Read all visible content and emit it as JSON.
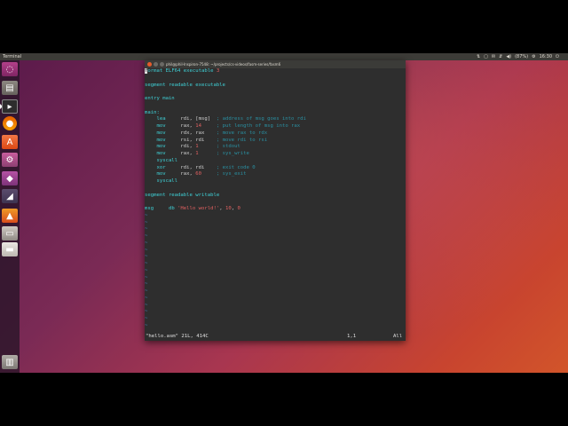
{
  "topbar": {
    "app_name": "Terminal",
    "indicators": [
      "⇅",
      "▢",
      "✉",
      "⇵",
      "◀)",
      "(87%)",
      "⚙",
      "16:30",
      "⏻"
    ]
  },
  "launcher": {
    "items": [
      {
        "name": "ubuntu-dash"
      },
      {
        "name": "files"
      },
      {
        "name": "terminal"
      },
      {
        "name": "firefox"
      },
      {
        "name": "software-center"
      },
      {
        "name": "system-settings"
      },
      {
        "name": "app"
      },
      {
        "name": "app"
      },
      {
        "name": "app"
      },
      {
        "name": "app"
      },
      {
        "name": "app"
      },
      {
        "name": "trash"
      }
    ]
  },
  "window": {
    "title": "phil@phil-Inspiron-7548: ~/projects/cs-videos/fasm-series/fasm6"
  },
  "editor": {
    "lines": [
      [
        {
          "t": "f",
          "c": "cursor"
        },
        {
          "t": "ormat ELF64 executable ",
          "c": "kw"
        },
        {
          "t": "3",
          "c": "num"
        }
      ],
      [],
      [
        {
          "t": "segment readable executable",
          "c": "kw"
        }
      ],
      [],
      [
        {
          "t": "entry main",
          "c": "kw"
        }
      ],
      [],
      [
        {
          "t": "main:",
          "c": "lbl"
        }
      ],
      [
        {
          "t": "    lea     ",
          "c": "mnem"
        },
        {
          "t": "rdi, [msg]  ",
          "c": "plain"
        },
        {
          "t": "; address of msg goes into rdi",
          "c": "cmt"
        }
      ],
      [
        {
          "t": "    mov     ",
          "c": "mnem"
        },
        {
          "t": "rax, ",
          "c": "plain"
        },
        {
          "t": "14",
          "c": "num"
        },
        {
          "t": "     ",
          "c": "plain"
        },
        {
          "t": "; put length of msg into rax",
          "c": "cmt"
        }
      ],
      [
        {
          "t": "    mov     ",
          "c": "mnem"
        },
        {
          "t": "rdx, rax    ",
          "c": "plain"
        },
        {
          "t": "; move rax to rdx",
          "c": "cmt"
        }
      ],
      [
        {
          "t": "    mov     ",
          "c": "mnem"
        },
        {
          "t": "rsi, rdi    ",
          "c": "plain"
        },
        {
          "t": "; move rdi to rsi",
          "c": "cmt"
        }
      ],
      [
        {
          "t": "    mov     ",
          "c": "mnem"
        },
        {
          "t": "rdi, ",
          "c": "plain"
        },
        {
          "t": "1",
          "c": "num"
        },
        {
          "t": "      ",
          "c": "plain"
        },
        {
          "t": "; stdout",
          "c": "cmt"
        }
      ],
      [
        {
          "t": "    mov     ",
          "c": "mnem"
        },
        {
          "t": "rax, ",
          "c": "plain"
        },
        {
          "t": "1",
          "c": "num"
        },
        {
          "t": "      ",
          "c": "plain"
        },
        {
          "t": "; sys_write",
          "c": "cmt"
        }
      ],
      [
        {
          "t": "    syscall",
          "c": "mnem"
        }
      ],
      [
        {
          "t": "    xor     ",
          "c": "mnem"
        },
        {
          "t": "rdi, rdi    ",
          "c": "plain"
        },
        {
          "t": "; exit code 0",
          "c": "cmt"
        }
      ],
      [
        {
          "t": "    mov     ",
          "c": "mnem"
        },
        {
          "t": "rax, ",
          "c": "plain"
        },
        {
          "t": "60",
          "c": "num"
        },
        {
          "t": "     ",
          "c": "plain"
        },
        {
          "t": "; sys_exit",
          "c": "cmt"
        }
      ],
      [
        {
          "t": "    syscall",
          "c": "mnem"
        }
      ],
      [],
      [
        {
          "t": "segment readable writable",
          "c": "kw"
        }
      ],
      [],
      [
        {
          "t": "msg     ",
          "c": "lbl"
        },
        {
          "t": "db ",
          "c": "mnem"
        },
        {
          "t": "'Hello world!'",
          "c": "str"
        },
        {
          "t": ", ",
          "c": "plain"
        },
        {
          "t": "10",
          "c": "num"
        },
        {
          "t": ", ",
          "c": "plain"
        },
        {
          "t": "0",
          "c": "num"
        }
      ]
    ],
    "empty_line_marker": "~",
    "empty_line_count": 17
  },
  "statusline": {
    "file": "\"hello.asm\" 21L, 414C",
    "position": "1,1",
    "scroll": "All"
  },
  "colors": {
    "keyword": "#3fd0d6",
    "comment": "#2a8fa1",
    "number": "#e06060",
    "tilde": "#4a7ab8",
    "terminal_bg": "#2e2e2e"
  }
}
